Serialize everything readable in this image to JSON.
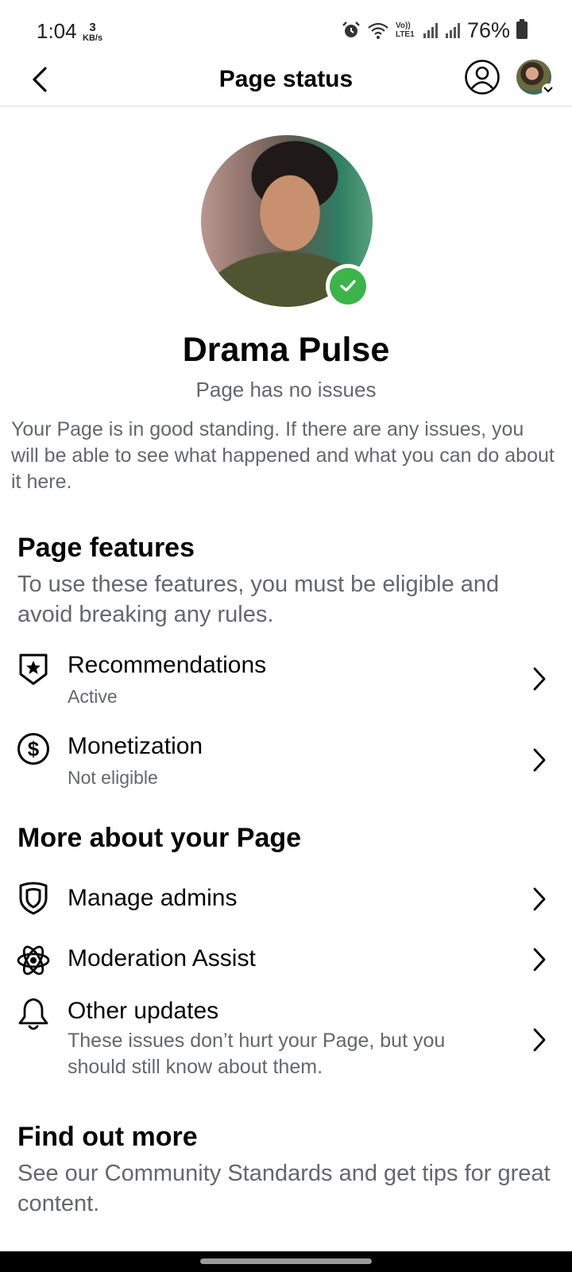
{
  "status_bar": {
    "time": "1:04",
    "kbs_value": "3",
    "kbs_unit": "KB/s",
    "network_label": "Vo)) LTE1",
    "battery_percent": "76%"
  },
  "header": {
    "title": "Page status"
  },
  "profile": {
    "name": "Drama Pulse",
    "status": "Page has no issues",
    "description": "Your Page is in good standing. If there are any issues, you will be able to see what happened and what you can do about it here."
  },
  "page_features": {
    "title": "Page features",
    "subtitle": "To use these features, you must be eligible and avoid breaking any rules.",
    "items": [
      {
        "title": "Recommendations",
        "subtitle": "Active",
        "icon": "shield-star-icon"
      },
      {
        "title": "Monetization",
        "subtitle": "Not eligible",
        "icon": "dollar-circle-icon"
      }
    ]
  },
  "more_about": {
    "title": "More about your Page",
    "items": [
      {
        "title": "Manage admins",
        "icon": "shield-icon"
      },
      {
        "title": "Moderation Assist",
        "icon": "atom-icon"
      },
      {
        "title": "Other updates",
        "subtitle": "These issues don’t hurt your Page, but you should still know about them.",
        "icon": "bell-icon"
      }
    ]
  },
  "find_out_more": {
    "title": "Find out more",
    "subtitle": "See our Community Standards and get tips for great content."
  },
  "colors": {
    "verified_green": "#3cb44a",
    "secondary_text": "#65676b",
    "primary_text": "#050505"
  }
}
